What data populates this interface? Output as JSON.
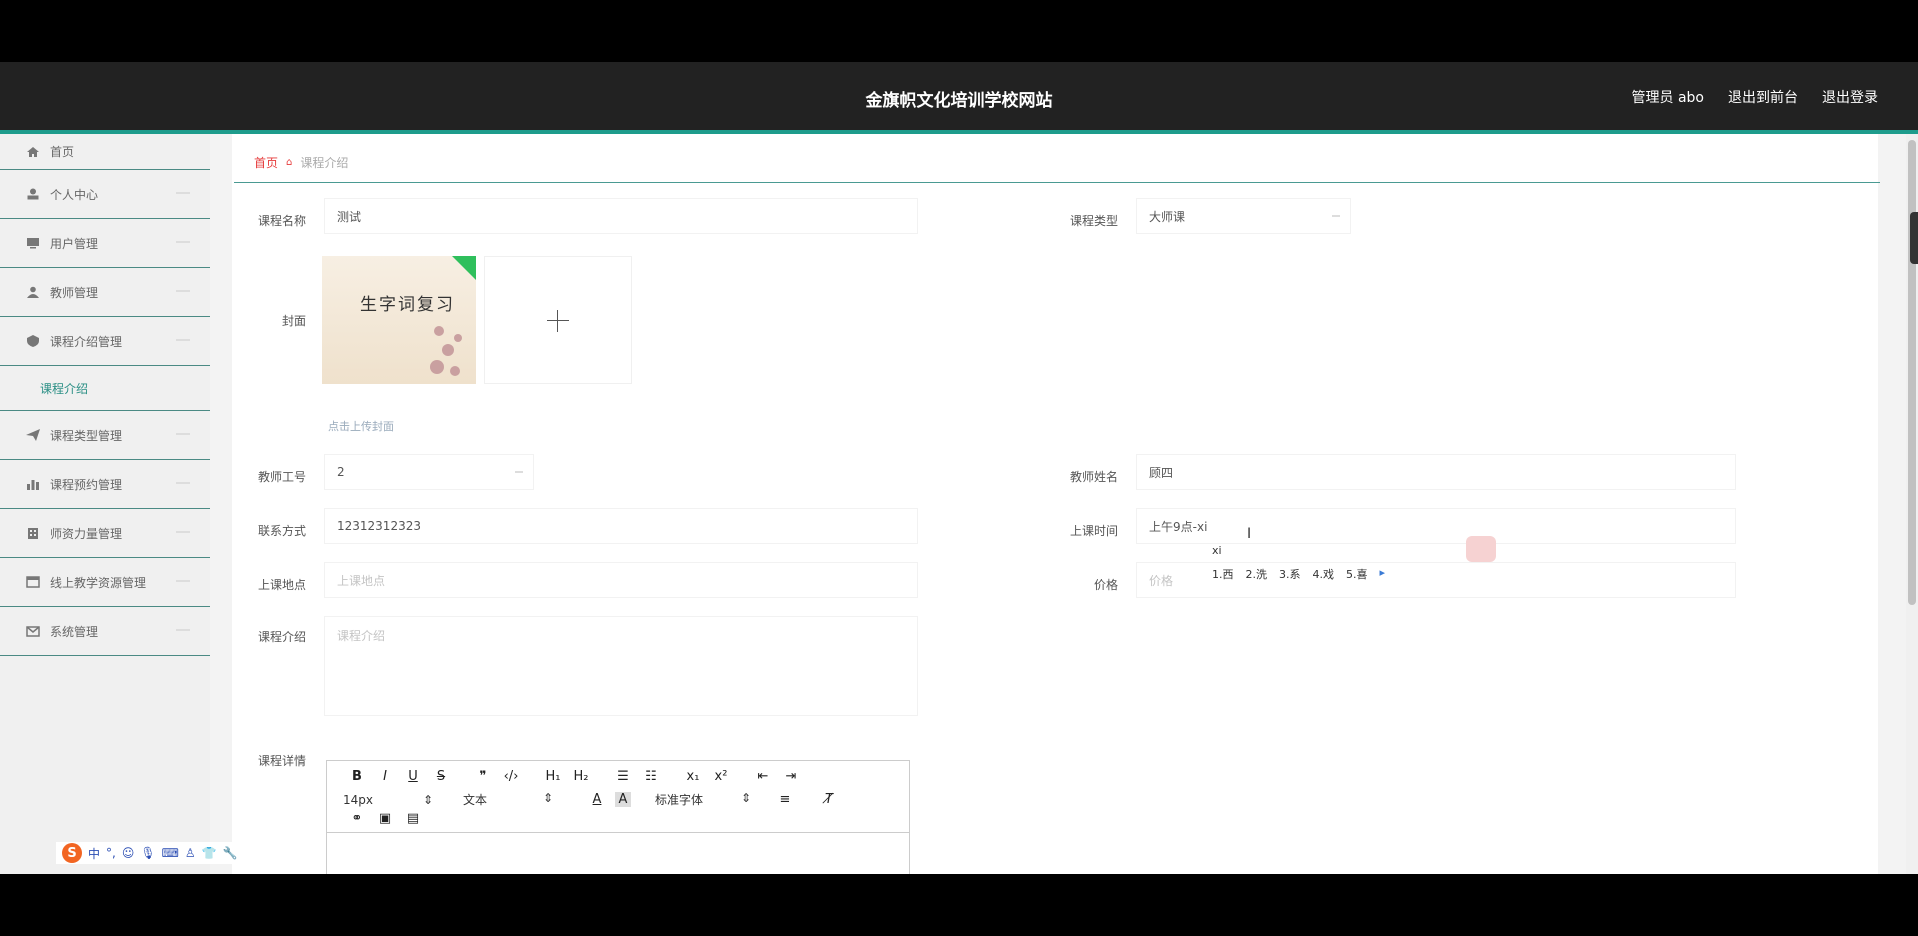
{
  "header": {
    "title": "金旗帜文化培训学校网站",
    "links": [
      "管理员 abo",
      "退出到前台",
      "退出登录"
    ]
  },
  "sidebar": {
    "items": [
      {
        "label": "首页",
        "icon": "home-icon"
      },
      {
        "label": "个人中心",
        "icon": "user-icon"
      },
      {
        "label": "用户管理",
        "icon": "monitor-icon"
      },
      {
        "label": "教师管理",
        "icon": "teacher-icon"
      },
      {
        "label": "课程介绍管理",
        "icon": "shield-icon"
      },
      {
        "label": "课程类型管理",
        "icon": "send-icon"
      },
      {
        "label": "课程预约管理",
        "icon": "bar-chart-icon"
      },
      {
        "label": "师资力量管理",
        "icon": "building-icon"
      },
      {
        "label": "线上教学资源管理",
        "icon": "window-icon"
      },
      {
        "label": "系统管理",
        "icon": "mail-icon"
      }
    ],
    "sub_item": "课程介绍"
  },
  "breadcrumb": {
    "home": "首页",
    "current": "课程介绍"
  },
  "form": {
    "course_name": {
      "label": "课程名称",
      "value": "测试"
    },
    "course_type": {
      "label": "课程类型",
      "value": "大师课"
    },
    "cover": {
      "label": "封面",
      "image_text": "生字词复习",
      "hint": "点击上传封面"
    },
    "teacher_id": {
      "label": "教师工号",
      "value": "2"
    },
    "teacher_name": {
      "label": "教师姓名",
      "value": "顾四"
    },
    "contact": {
      "label": "联系方式",
      "value": "12312312323"
    },
    "class_time": {
      "label": "上课时间",
      "value": "上午9点-xi"
    },
    "location": {
      "label": "上课地点",
      "placeholder": "上课地点"
    },
    "price": {
      "label": "价格",
      "placeholder": "价格"
    },
    "intro": {
      "label": "课程介绍",
      "placeholder": "课程介绍"
    },
    "detail": {
      "label": "课程详情"
    }
  },
  "editor": {
    "row1": [
      "B",
      "I",
      "U",
      "S",
      "❞",
      "‹/›",
      "H₁",
      "H₂",
      "☰",
      "☷",
      "x₁",
      "x²",
      "⇤",
      "⇥"
    ],
    "font_size": "14px",
    "block_format": "文本",
    "font_family": "标准字体"
  },
  "ime": {
    "composing": "xi",
    "candidates": [
      "1.西",
      "2.洗",
      "3.系",
      "4.戏",
      "5.喜"
    ]
  },
  "ime_bar": {
    "lang": "中"
  },
  "colors": {
    "accent": "#1e9c8c",
    "header_bg": "#222222",
    "breadcrumb_home": "#e63b3b"
  }
}
